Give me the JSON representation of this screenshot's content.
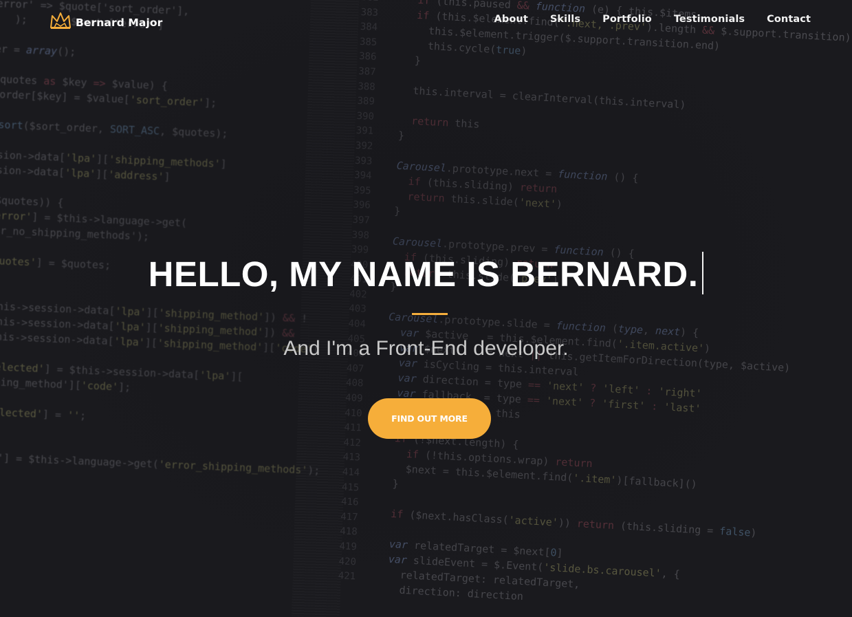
{
  "brand": {
    "name": "Bernard Major",
    "accent": "#f6ae3a",
    "icon": "crown-icon"
  },
  "nav": {
    "items": [
      {
        "label": "About"
      },
      {
        "label": "Skills"
      },
      {
        "label": "Portfolio"
      },
      {
        "label": "Testimonials"
      },
      {
        "label": "Contact"
      }
    ]
  },
  "hero": {
    "headline": "HELLO, MY NAME IS BERNARD.",
    "subtitle": "And I'm a Front-End developer.",
    "cta_label": "FIND OUT MORE",
    "background": "code-editor-screenshot"
  }
}
